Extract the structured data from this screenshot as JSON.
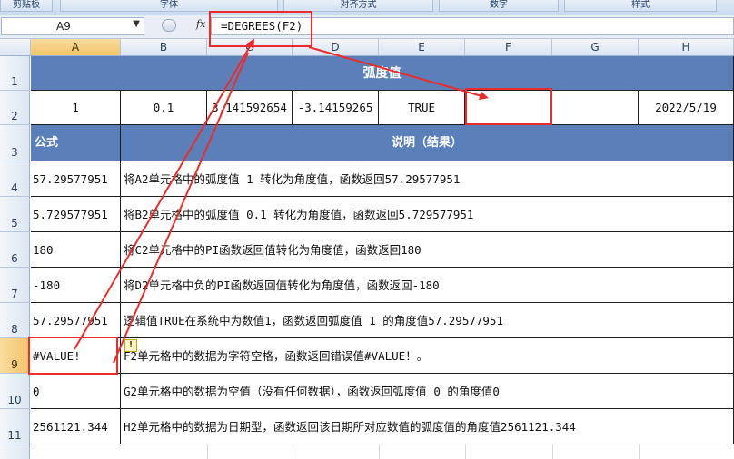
{
  "ribbon": {
    "groups": [
      "剪贴板",
      "字体",
      "对齐方式",
      "数字",
      "样式"
    ]
  },
  "formula_bar": {
    "name_box": "A9",
    "fx_label": "fx",
    "formula": "=DEGREES(F2)"
  },
  "columns": [
    "A",
    "B",
    "C",
    "D",
    "E",
    "F",
    "G",
    "H"
  ],
  "rows": [
    "1",
    "2",
    "3",
    "4",
    "5",
    "6",
    "7",
    "8",
    "9",
    "10",
    "11"
  ],
  "sheet": {
    "title": "弧度值",
    "row2": [
      "1",
      "0.1",
      "3.141592654",
      "-3.14159265",
      "TRUE",
      "",
      "",
      "2022/5/19"
    ],
    "header_formula": "公式",
    "header_desc": "说明（结果）",
    "rows": [
      {
        "formula": "57.29577951",
        "desc": "将A2单元格中的弧度值 1 转化为角度值，函数返回57.29577951"
      },
      {
        "formula": "5.729577951",
        "desc": "将B2单元格中的弧度值 0.1 转化为角度值，函数返回5.729577951"
      },
      {
        "formula": "180",
        "desc": "将C2单元格中的PI函数返回值转化为角度值，函数返回180"
      },
      {
        "formula": "-180",
        "desc": "将D2单元格中负的PI函数返回值转化为角度值，函数返回-180"
      },
      {
        "formula": "57.29577951",
        "desc": "逻辑值TRUE在系统中为数值1，函数返回弧度值 1 的角度值57.29577951"
      },
      {
        "formula": "#VALUE!",
        "desc": "F2单元格中的数据为字符空格，函数返回错误值#VALUE！。"
      },
      {
        "formula": "0",
        "desc": "G2单元格中的数据为空值（没有任何数据），函数返回弧度值 0 的角度值0"
      },
      {
        "formula": "2561121.344",
        "desc": "H2单元格中的数据为日期型，函数返回该日期所对应数值的弧度值的角度值2561121.344"
      }
    ]
  },
  "colors": {
    "header_band": "#5b7fb8",
    "annotation": "#ee2b2b",
    "selected_header": "#f2c46a"
  }
}
